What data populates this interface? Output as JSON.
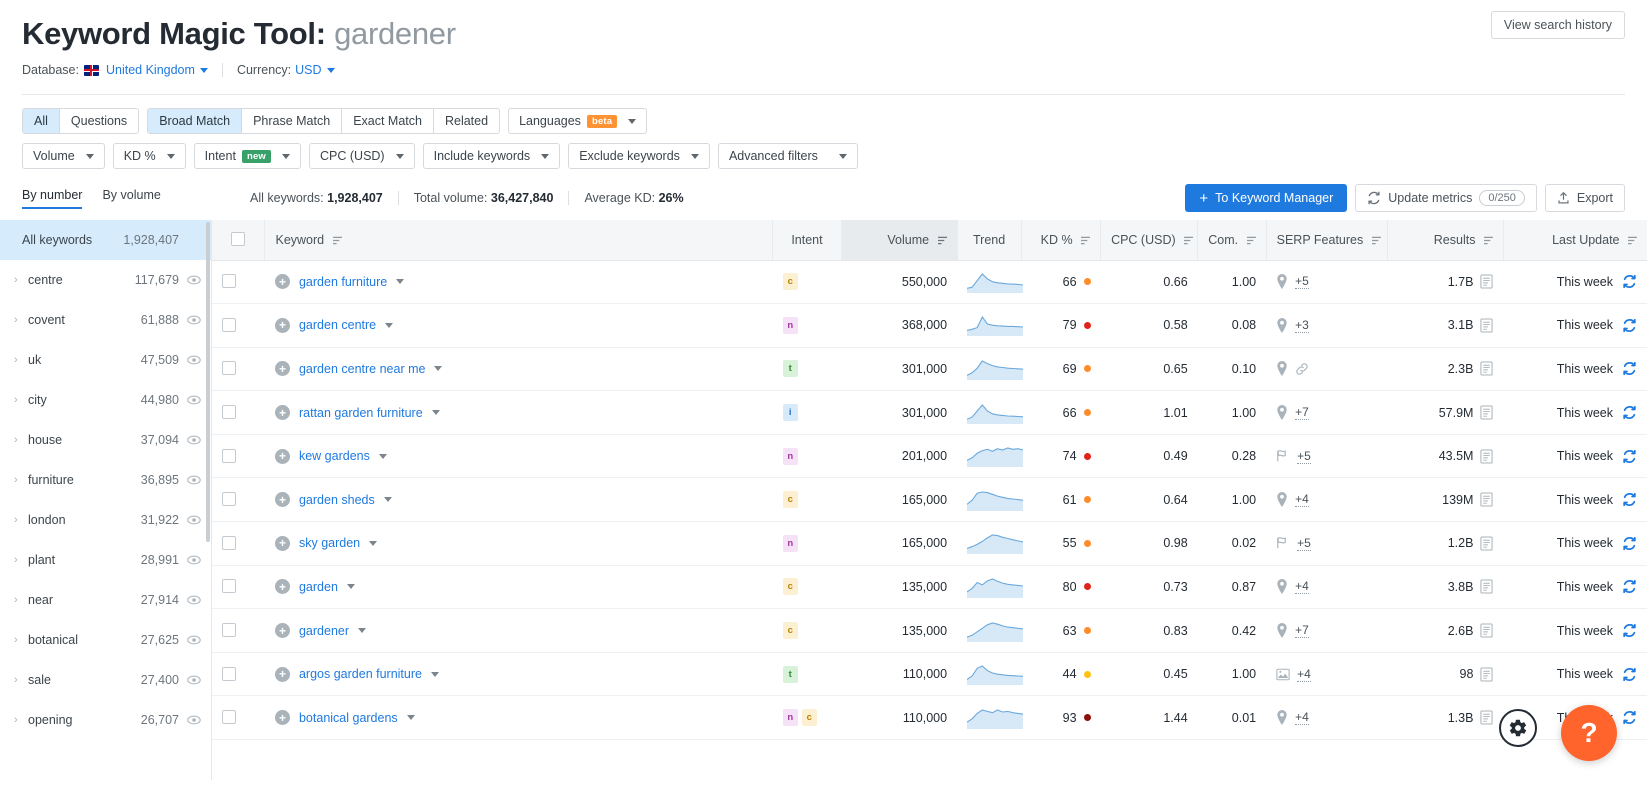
{
  "header": {
    "title_prefix": "Keyword Magic Tool:",
    "title_term": "gardener",
    "database_label": "Database:",
    "database_value": "United Kingdom",
    "currency_label": "Currency:",
    "currency_value": "USD",
    "view_history_button": "View search history"
  },
  "filters": {
    "match_group_1": [
      "All",
      "Questions"
    ],
    "match_group_1_active": "All",
    "match_group_2": [
      "Broad Match",
      "Phrase Match",
      "Exact Match",
      "Related"
    ],
    "match_group_2_active": "Broad Match",
    "languages_label": "Languages",
    "languages_badge": "beta",
    "dropdowns": [
      {
        "label": "Volume",
        "badge": null
      },
      {
        "label": "KD %",
        "badge": null
      },
      {
        "label": "Intent",
        "badge": "new"
      },
      {
        "label": "CPC (USD)",
        "badge": null
      },
      {
        "label": "Include keywords",
        "badge": null
      },
      {
        "label": "Exclude keywords",
        "badge": null
      },
      {
        "label": "Advanced filters",
        "badge": null
      }
    ]
  },
  "stats": {
    "tabs": [
      "By number",
      "By volume"
    ],
    "active_tab": "By number",
    "all_keywords_label": "All keywords:",
    "all_keywords_value": "1,928,407",
    "total_volume_label": "Total volume:",
    "total_volume_value": "36,427,840",
    "average_kd_label": "Average KD:",
    "average_kd_value": "26%",
    "to_keyword_manager_button": "To Keyword Manager",
    "update_metrics_button": "Update metrics",
    "update_metrics_counter": "0/250",
    "export_button": "Export"
  },
  "sidebar": {
    "all_label": "All keywords",
    "all_count": "1,928,407",
    "items": [
      {
        "label": "centre",
        "count": "117,679"
      },
      {
        "label": "covent",
        "count": "61,888"
      },
      {
        "label": "uk",
        "count": "47,509"
      },
      {
        "label": "city",
        "count": "44,980"
      },
      {
        "label": "house",
        "count": "37,094"
      },
      {
        "label": "furniture",
        "count": "36,895"
      },
      {
        "label": "london",
        "count": "31,922"
      },
      {
        "label": "plant",
        "count": "28,991"
      },
      {
        "label": "near",
        "count": "27,914"
      },
      {
        "label": "botanical",
        "count": "27,625"
      },
      {
        "label": "sale",
        "count": "27,400"
      },
      {
        "label": "opening",
        "count": "26,707"
      }
    ]
  },
  "table": {
    "columns": [
      "Keyword",
      "Intent",
      "Volume",
      "Trend",
      "KD %",
      "CPC (USD)",
      "Com.",
      "SERP Features",
      "Results",
      "Last Update"
    ],
    "rows": [
      {
        "keyword": "garden furniture",
        "intent": [
          "C"
        ],
        "volume": "550,000",
        "trend": [
          10,
          14,
          38,
          62,
          44,
          34,
          30,
          28,
          26,
          25,
          24,
          22
        ],
        "kd": "66",
        "kd_color": "#ff8c2b",
        "cpc": "0.66",
        "com": "1.00",
        "serp_icon": "map-pin",
        "serp_extra": "+5",
        "results": "1.7B",
        "last_update": "This week"
      },
      {
        "keyword": "garden centre",
        "intent": [
          "N"
        ],
        "volume": "368,000",
        "trend": [
          12,
          16,
          22,
          58,
          34,
          30,
          28,
          27,
          26,
          26,
          25,
          24
        ],
        "kd": "79",
        "kd_color": "#e2231a",
        "cpc": "0.58",
        "com": "0.08",
        "serp_icon": "map-pin",
        "serp_extra": "+3",
        "results": "3.1B",
        "last_update": "This week"
      },
      {
        "keyword": "garden centre near me",
        "intent": [
          "T"
        ],
        "volume": "301,000",
        "trend": [
          8,
          16,
          30,
          52,
          44,
          38,
          34,
          32,
          30,
          29,
          28,
          27
        ],
        "kd": "69",
        "kd_color": "#ff8c2b",
        "cpc": "0.65",
        "com": "0.10",
        "serp_icon": "map-pin",
        "serp_extra": "link",
        "results": "2.3B",
        "last_update": "This week"
      },
      {
        "keyword": "rattan garden furniture",
        "intent": [
          "I"
        ],
        "volume": "301,000",
        "trend": [
          10,
          18,
          40,
          62,
          40,
          30,
          26,
          24,
          22,
          21,
          20,
          19
        ],
        "kd": "66",
        "kd_color": "#ff8c2b",
        "cpc": "1.01",
        "com": "1.00",
        "serp_icon": "map-pin",
        "serp_extra": "+7",
        "results": "57.9M",
        "last_update": "This week"
      },
      {
        "keyword": "kew gardens",
        "intent": [
          "N"
        ],
        "volume": "201,000",
        "trend": [
          14,
          22,
          36,
          44,
          48,
          42,
          50,
          46,
          52,
          48,
          50,
          46
        ],
        "kd": "74",
        "kd_color": "#e2231a",
        "cpc": "0.49",
        "com": "0.28",
        "serp_icon": "flag",
        "serp_extra": "+5",
        "results": "43.5M",
        "last_update": "This week"
      },
      {
        "keyword": "garden sheds",
        "intent": [
          "C"
        ],
        "volume": "165,000",
        "trend": [
          16,
          30,
          54,
          58,
          56,
          50,
          44,
          40,
          36,
          34,
          32,
          30
        ],
        "kd": "61",
        "kd_color": "#ff8c2b",
        "cpc": "0.64",
        "com": "1.00",
        "serp_icon": "map-pin",
        "serp_extra": "+4",
        "results": "139M",
        "last_update": "This week"
      },
      {
        "keyword": "sky garden",
        "intent": [
          "N"
        ],
        "volume": "165,000",
        "trend": [
          12,
          18,
          26,
          36,
          48,
          58,
          56,
          50,
          46,
          42,
          38,
          34
        ],
        "kd": "55",
        "kd_color": "#ff8c2b",
        "cpc": "0.98",
        "com": "0.02",
        "serp_icon": "flag",
        "serp_extra": "+5",
        "results": "1.2B",
        "last_update": "This week"
      },
      {
        "keyword": "garden",
        "intent": [
          "C"
        ],
        "volume": "135,000",
        "trend": [
          14,
          26,
          46,
          38,
          52,
          58,
          50,
          44,
          40,
          38,
          36,
          34
        ],
        "kd": "80",
        "kd_color": "#e2231a",
        "cpc": "0.73",
        "com": "0.87",
        "serp_icon": "map-pin",
        "serp_extra": "+4",
        "results": "3.8B",
        "last_update": "This week"
      },
      {
        "keyword": "gardener",
        "intent": [
          "C"
        ],
        "volume": "135,000",
        "trend": [
          10,
          16,
          28,
          40,
          52,
          58,
          54,
          48,
          44,
          42,
          40,
          38
        ],
        "kd": "63",
        "kd_color": "#ff8c2b",
        "cpc": "0.83",
        "com": "0.42",
        "serp_icon": "map-pin",
        "serp_extra": "+7",
        "results": "2.6B",
        "last_update": "This week"
      },
      {
        "keyword": "argos garden furniture",
        "intent": [
          "T"
        ],
        "volume": "110,000",
        "trend": [
          12,
          24,
          50,
          58,
          42,
          34,
          30,
          28,
          26,
          25,
          24,
          23
        ],
        "kd": "44",
        "kd_color": "#ffc20e",
        "cpc": "0.45",
        "com": "1.00",
        "serp_icon": "image",
        "serp_extra": "+4",
        "results": "98",
        "last_update": "This week"
      },
      {
        "keyword": "botanical gardens",
        "intent": [
          "N",
          "C"
        ],
        "volume": "110,000",
        "trend": [
          14,
          24,
          40,
          50,
          46,
          42,
          50,
          44,
          46,
          42,
          40,
          38
        ],
        "kd": "93",
        "kd_color": "#8c1008",
        "cpc": "1.44",
        "com": "0.01",
        "serp_icon": "map-pin",
        "serp_extra": "+4",
        "results": "1.3B",
        "last_update": "This week"
      }
    ]
  },
  "floating": {
    "gear_label": "gear-settings",
    "help_label": "?"
  },
  "colors": {
    "accent_blue": "#1f7ae0",
    "highlight_blue": "#d6ebfb",
    "orange_fab": "#ff642d",
    "beta_badge": "#ff9232",
    "new_badge": "#38a169"
  }
}
